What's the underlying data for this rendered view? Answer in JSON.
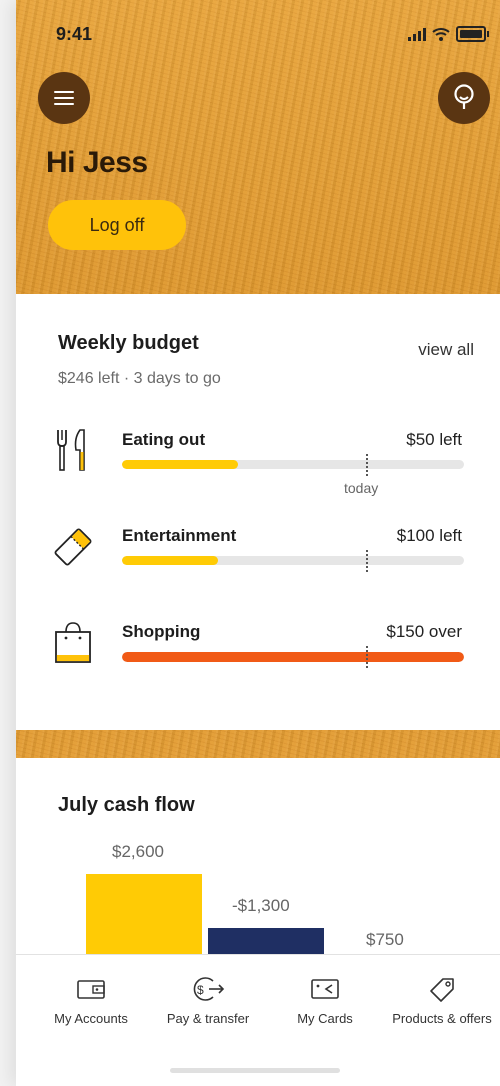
{
  "status": {
    "time": "9:41"
  },
  "header": {
    "greeting": "Hi Jess",
    "logoff_label": "Log off"
  },
  "budget": {
    "title": "Weekly budget",
    "view_all": "view all",
    "summary": "$246 left · 3 days to go",
    "today_label": "today",
    "categories": [
      {
        "name": "Eating out",
        "amount": "$50 left",
        "progress": 0.34,
        "color": "#ffcb05",
        "icon": "cutlery-icon"
      },
      {
        "name": "Entertainment",
        "amount": "$100 left",
        "progress": 0.28,
        "color": "#ffcb05",
        "icon": "ticket-icon"
      },
      {
        "name": "Shopping",
        "amount": "$150 over",
        "progress": 1.0,
        "color": "#f15a16",
        "icon": "shopping-bag-icon"
      }
    ]
  },
  "cashflow": {
    "title": "July cash flow",
    "labels": [
      "$2,600",
      "-$1,300",
      "$750"
    ]
  },
  "tabs": [
    {
      "label": "My Accounts",
      "icon": "wallet-icon"
    },
    {
      "label": "Pay & transfer",
      "icon": "pay-transfer-icon"
    },
    {
      "label": "My Cards",
      "icon": "card-icon"
    },
    {
      "label": "Products & offers",
      "icon": "tag-icon"
    }
  ],
  "colors": {
    "accent": "#ffc20a",
    "navy": "#1f2f63",
    "overspend": "#f15a16",
    "header_button": "#5a3512"
  }
}
